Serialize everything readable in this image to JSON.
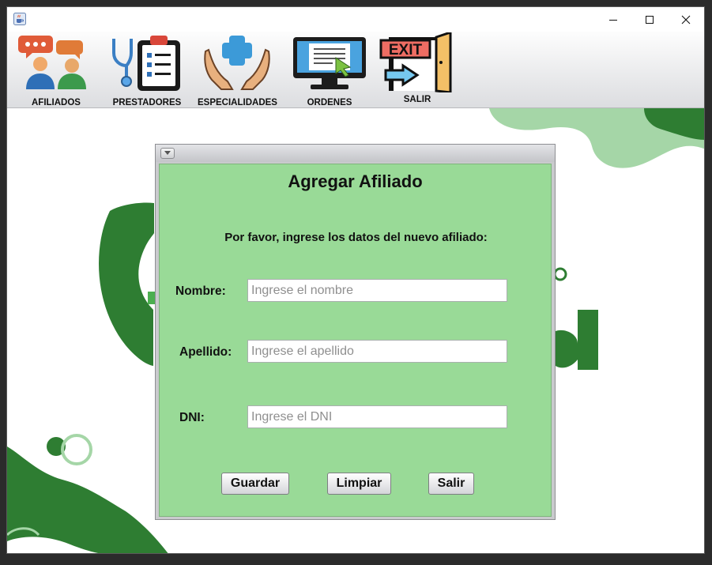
{
  "window": {
    "title": "",
    "icon": "java-cup-icon"
  },
  "window_controls": {
    "minimize": "minimize-icon",
    "maximize": "maximize-icon",
    "close": "close-icon"
  },
  "toolbar": {
    "items": [
      {
        "label": "AFILIADOS",
        "icon": "people-chat-icon"
      },
      {
        "label": "PRESTADORES",
        "icon": "stethoscope-clipboard-icon"
      },
      {
        "label": "ESPECIALIDADES",
        "icon": "hands-medical-cross-icon"
      },
      {
        "label": "ORDENES",
        "icon": "monitor-document-icon"
      },
      {
        "label": "SALIR",
        "icon": "exit-door-icon"
      }
    ]
  },
  "exit_sign": "EXIT",
  "dialog": {
    "title": "Agregar Afiliado",
    "instructions": "Por favor, ingrese los datos del nuevo afiliado:",
    "fields": {
      "nombre": {
        "label": "Nombre:",
        "placeholder": "Ingrese el nombre",
        "value": ""
      },
      "apellido": {
        "label": "Apellido:",
        "placeholder": "Ingrese el apellido",
        "value": ""
      },
      "dni": {
        "label": "DNI:",
        "placeholder": "Ingrese el DNI",
        "value": ""
      }
    },
    "buttons": {
      "save": "Guardar",
      "clear": "Limpiar",
      "exit": "Salir"
    }
  },
  "colors": {
    "form_background": "#99da97",
    "brand_dark_green": "#2e7d32",
    "brand_light_green": "#a5d6a7"
  }
}
